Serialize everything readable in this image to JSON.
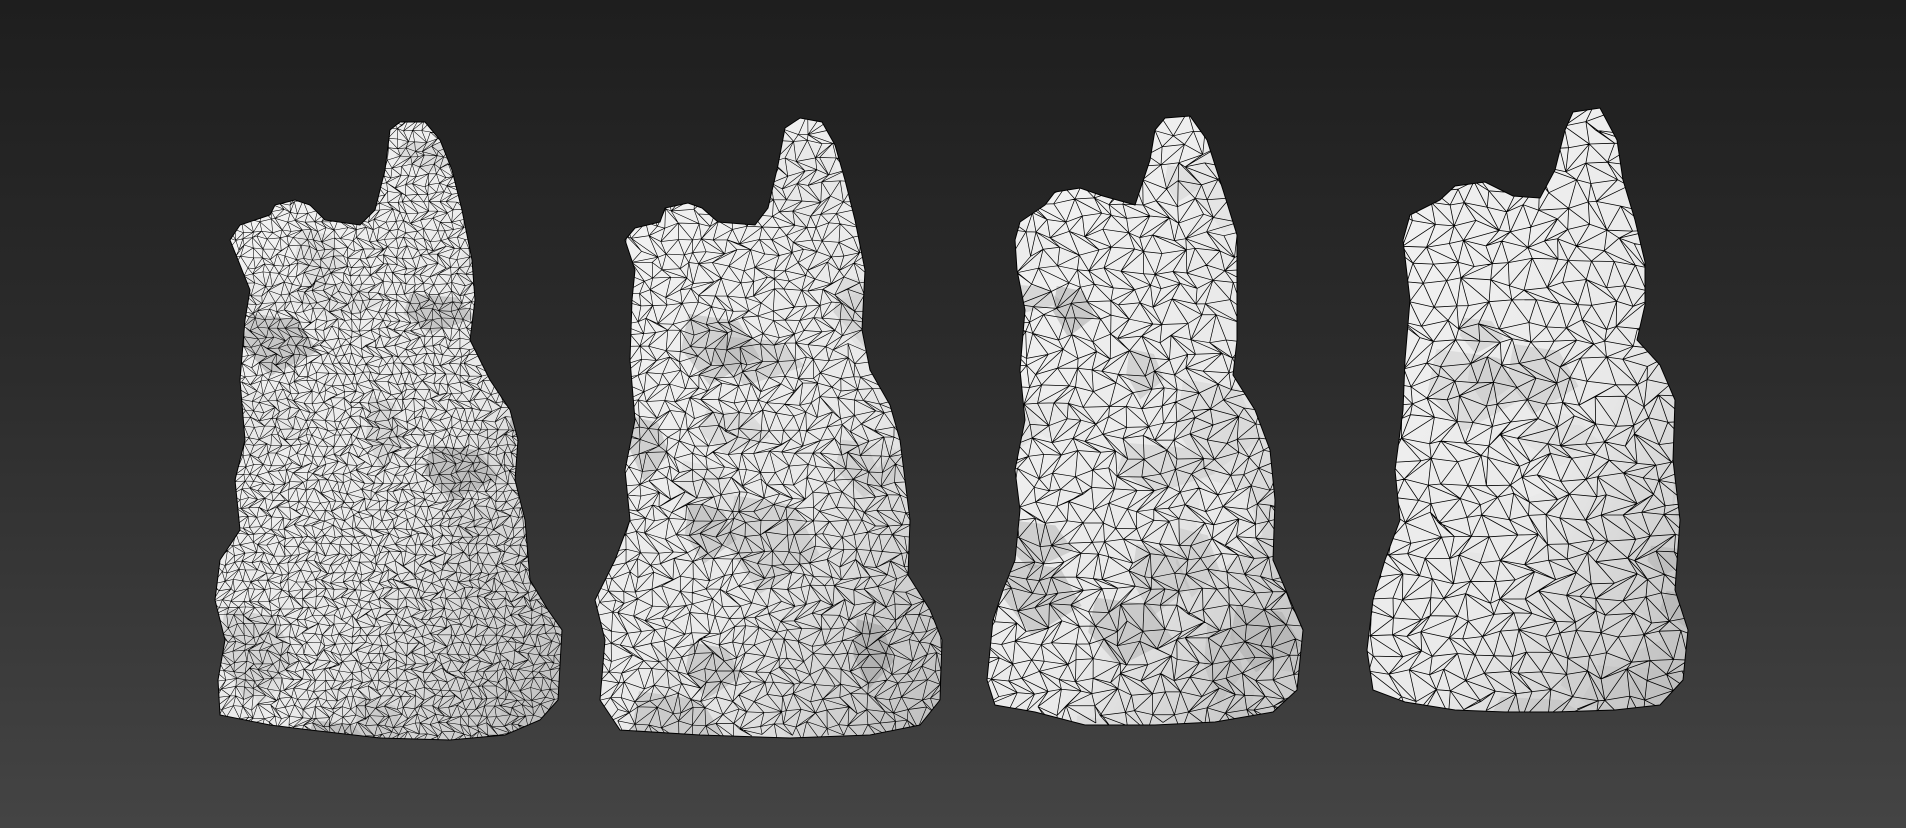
{
  "scene": {
    "background_top": "#1e1e1e",
    "background_bottom": "#444444",
    "models": [
      {
        "name": "rock-pillar",
        "density": 1.0
      },
      {
        "name": "rock-pillar",
        "density": 0.72
      },
      {
        "name": "rock-pillar",
        "density": 0.5
      },
      {
        "name": "rock-pillar",
        "density": 0.34
      }
    ],
    "shade": "#e9e9e9",
    "wire_color": "#000000"
  }
}
